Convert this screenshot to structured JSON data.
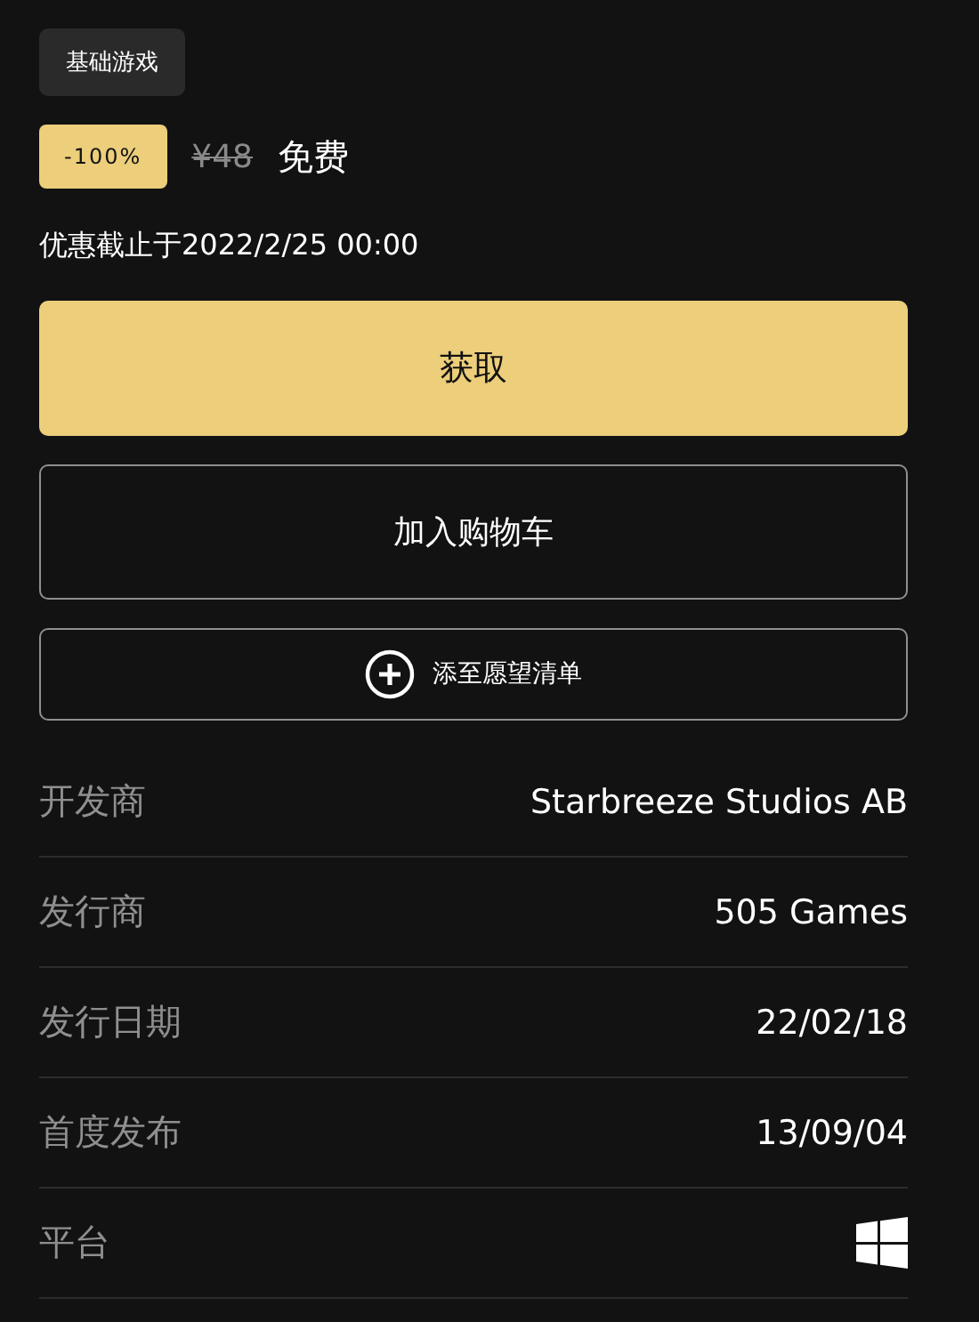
{
  "edition_tag": "基础游戏",
  "price": {
    "discount": "-100%",
    "original": "¥48",
    "current": "免费"
  },
  "offer_end": "优惠截止于2022/2/25 00:00",
  "buttons": [
    {
      "kind": "primary",
      "label": "获取"
    },
    {
      "kind": "outline",
      "label": "加入购物车"
    },
    {
      "kind": "wishlist",
      "label": "添至愿望清单"
    }
  ],
  "details": [
    {
      "kind": "text",
      "label": "开发商",
      "value": "Starbreeze Studios AB"
    },
    {
      "kind": "text",
      "label": "发行商",
      "value": "505 Games"
    },
    {
      "kind": "text",
      "label": "发行日期",
      "value": "22/02/18"
    },
    {
      "kind": "text",
      "label": "首度发布",
      "value": "13/09/04"
    },
    {
      "kind": "platform",
      "label": "平台"
    }
  ]
}
